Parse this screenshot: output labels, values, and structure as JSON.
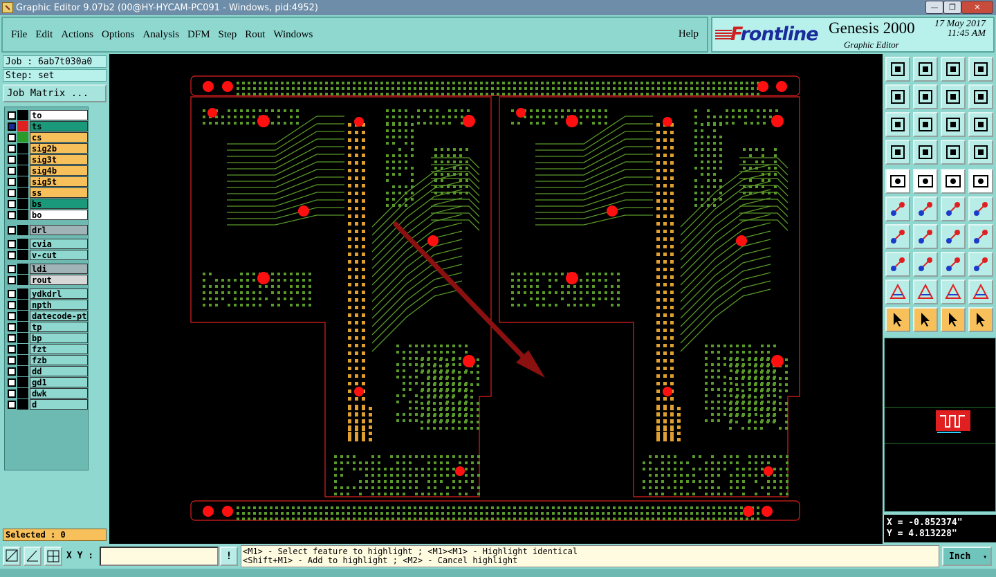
{
  "window": {
    "title": "Graphic Editor 9.07b2 (00@HY-HYCAM-PC091 - Windows, pid:4952)"
  },
  "menu": {
    "items": [
      "File",
      "Edit",
      "Actions",
      "Options",
      "Analysis",
      "DFM",
      "Step",
      "Rout",
      "Windows"
    ],
    "help": "Help"
  },
  "brand": {
    "logo": "Frontline",
    "product": "Genesis 2000",
    "subtitle": "Graphic Editor",
    "date": "17 May 2017",
    "time": "11:45 AM"
  },
  "job": {
    "job_label": "Job : 6ab7t030a0",
    "step_label": "Step: set",
    "matrix_button": "Job Matrix ..."
  },
  "layers": [
    {
      "name": "to",
      "bg": "#ffffff",
      "sw": "#000000",
      "group": 0
    },
    {
      "name": "ts",
      "bg": "#1a9a7a",
      "sw": "#e02020",
      "group": 0,
      "active": true
    },
    {
      "name": "cs",
      "bg": "#f8c05a",
      "sw": "#2a9a2a",
      "group": 0
    },
    {
      "name": "sig2b",
      "bg": "#f8c05a",
      "sw": "#000000",
      "group": 0
    },
    {
      "name": "sig3t",
      "bg": "#f8c05a",
      "sw": "#000000",
      "group": 0
    },
    {
      "name": "sig4b",
      "bg": "#f8c05a",
      "sw": "#000000",
      "group": 0
    },
    {
      "name": "sig5t",
      "bg": "#f8c05a",
      "sw": "#000000",
      "group": 0
    },
    {
      "name": "ss",
      "bg": "#f8c05a",
      "sw": "#000000",
      "group": 0
    },
    {
      "name": "bs",
      "bg": "#1a9a7a",
      "sw": "#000000",
      "group": 0
    },
    {
      "name": "bo",
      "bg": "#ffffff",
      "sw": "#000000",
      "group": 0
    },
    {
      "name": "drl",
      "bg": "#a0b4b8",
      "sw": "#000000",
      "group": 1
    },
    {
      "name": "cvia",
      "bg": "#8fd8d0",
      "sw": "#000000",
      "group": 2
    },
    {
      "name": "v-cut",
      "bg": "#8fd8d0",
      "sw": "#000000",
      "group": 2
    },
    {
      "name": "ldi",
      "bg": "#a0b4b8",
      "sw": "#000000",
      "group": 3
    },
    {
      "name": "rout",
      "bg": "#d8d8d8",
      "sw": "#000000",
      "group": 3
    },
    {
      "name": "ydkdrl",
      "bg": "#8fd8d0",
      "sw": "#000000",
      "group": 4
    },
    {
      "name": "npth",
      "bg": "#8fd8d0",
      "sw": "#000000",
      "group": 4
    },
    {
      "name": "datecode-pto",
      "bg": "#8fd8d0",
      "sw": "#000000",
      "group": 4
    },
    {
      "name": "tp",
      "bg": "#8fd8d0",
      "sw": "#000000",
      "group": 4
    },
    {
      "name": "bp",
      "bg": "#8fd8d0",
      "sw": "#000000",
      "group": 4
    },
    {
      "name": "fzt",
      "bg": "#8fd8d0",
      "sw": "#000000",
      "group": 4
    },
    {
      "name": "fzb",
      "bg": "#8fd8d0",
      "sw": "#000000",
      "group": 4
    },
    {
      "name": "dd",
      "bg": "#8fd8d0",
      "sw": "#000000",
      "group": 4
    },
    {
      "name": "gd1",
      "bg": "#8fd8d0",
      "sw": "#000000",
      "group": 4
    },
    {
      "name": "dwk",
      "bg": "#8fd8d0",
      "sw": "#000000",
      "group": 4
    },
    {
      "name": "d",
      "bg": "#8fd8d0",
      "sw": "#000000",
      "group": 4
    }
  ],
  "status": {
    "selected": "Selected : 0"
  },
  "coords": {
    "x": "X = -0.852374\"",
    "y": "Y = 4.813228\""
  },
  "bottom": {
    "xy_label": "X Y :",
    "xy_value": "",
    "hint_line1": "<M1> - Select feature to highlight ; <M1><M1> - Highlight identical",
    "hint_line2": "<Shift+M1> - Add to highlight ; <M2> - Cancel highlight",
    "unit": "Inch"
  },
  "colors": {
    "board_outline": "#e02020",
    "copper": "#5a9a2a",
    "pad": "#ff1010",
    "arrow": "#8b1010"
  }
}
